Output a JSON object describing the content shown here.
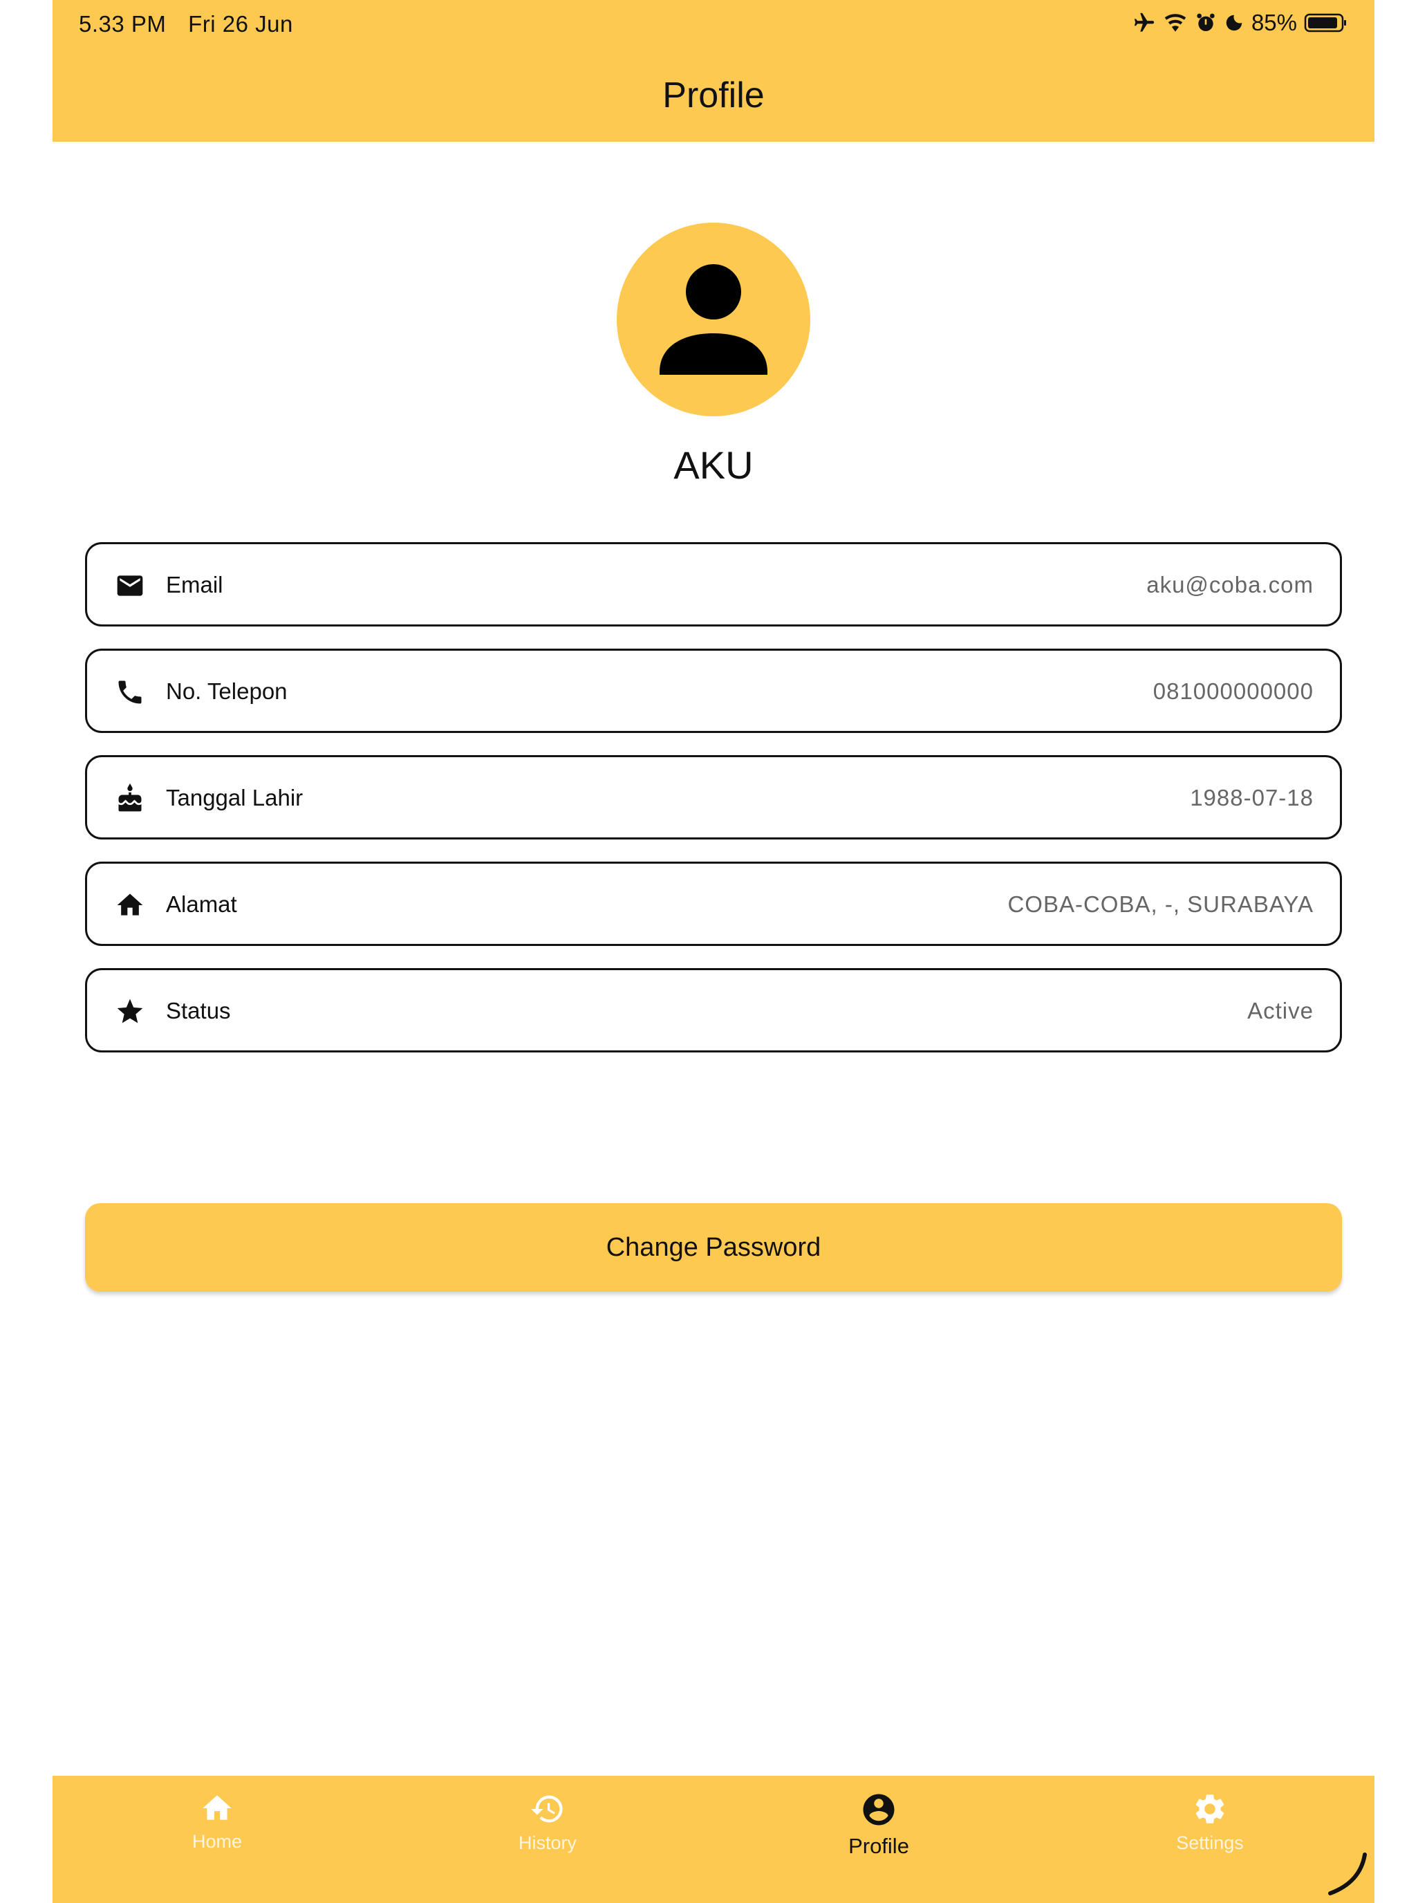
{
  "status_bar": {
    "time": "5.33 PM",
    "date": "Fri 26 Jun",
    "battery": "85%",
    "icons": [
      "airplane-icon",
      "wifi-icon",
      "alarm-icon",
      "moon-icon",
      "battery-icon"
    ]
  },
  "header": {
    "title": "Profile"
  },
  "profile": {
    "avatar_icon": "person-icon",
    "name": "AKU"
  },
  "fields": [
    {
      "icon": "mail-icon",
      "label": "Email",
      "value": "aku@coba.com"
    },
    {
      "icon": "phone-icon",
      "label": "No. Telepon",
      "value": "081000000000"
    },
    {
      "icon": "cake-icon",
      "label": "Tanggal Lahir",
      "value": "1988-07-18"
    },
    {
      "icon": "home-icon",
      "label": "Alamat",
      "value": "COBA-COBA, -, SURABAYA"
    },
    {
      "icon": "star-icon",
      "label": "Status",
      "value": "Active"
    }
  ],
  "actions": {
    "change_password": "Change Password"
  },
  "bottom_nav": {
    "items": [
      {
        "icon": "home-icon",
        "label": "Home",
        "active": false
      },
      {
        "icon": "history-icon",
        "label": "History",
        "active": false
      },
      {
        "icon": "account-circle-icon",
        "label": "Profile",
        "active": true
      },
      {
        "icon": "gear-icon",
        "label": "Settings",
        "active": false
      }
    ]
  },
  "colors": {
    "accent": "#FEC951",
    "text": "#111111",
    "value_text": "#666666"
  }
}
